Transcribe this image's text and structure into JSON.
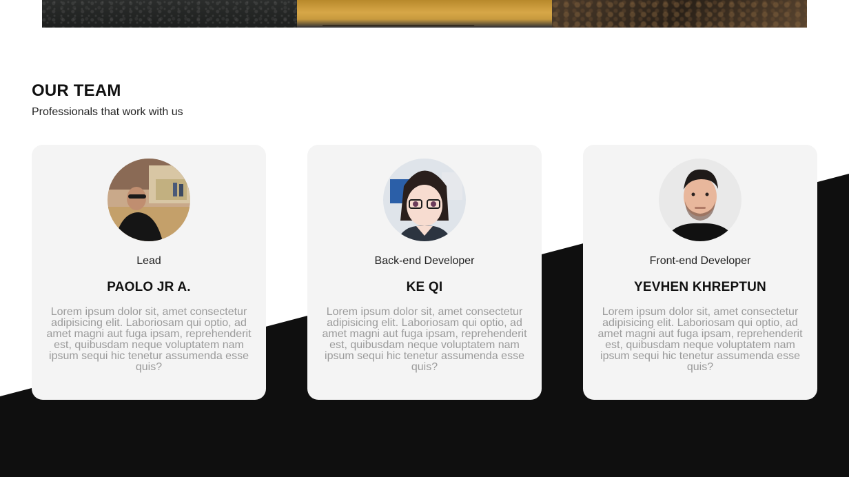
{
  "team": {
    "title": "OUR TEAM",
    "subtitle": "Professionals that work with us"
  },
  "members": [
    {
      "role": "Lead",
      "name": "PAOLO JR A.",
      "bio": "Lorem ipsum dolor sit, amet consectetur adipisicing elit. Laboriosam qui optio, ad amet magni aut fuga ipsam, reprehenderit est, quibusdam neque voluptatem nam ipsum sequi hic tenetur assumenda esse quis?"
    },
    {
      "role": "Back-end Developer",
      "name": "KE QI",
      "bio": "Lorem ipsum dolor sit, amet consectetur adipisicing elit. Laboriosam qui optio, ad amet magni aut fuga ipsam, reprehenderit est, quibusdam neque voluptatem nam ipsum sequi hic tenetur assumenda esse quis?"
    },
    {
      "role": "Front-end Developer",
      "name": "YEVHEN KHREPTUN",
      "bio": "Lorem ipsum dolor sit, amet consectetur adipisicing elit. Laboriosam qui optio, ad amet magni aut fuga ipsam, reprehenderit est, quibusdam neque voluptatem nam ipsum sequi hic tenetur assumenda esse quis?"
    }
  ],
  "colors": {
    "background": "#ffffff",
    "dark_band": "#0f0f0f",
    "card_bg": "#f4f4f4",
    "bio_text": "#9a9a9a"
  }
}
